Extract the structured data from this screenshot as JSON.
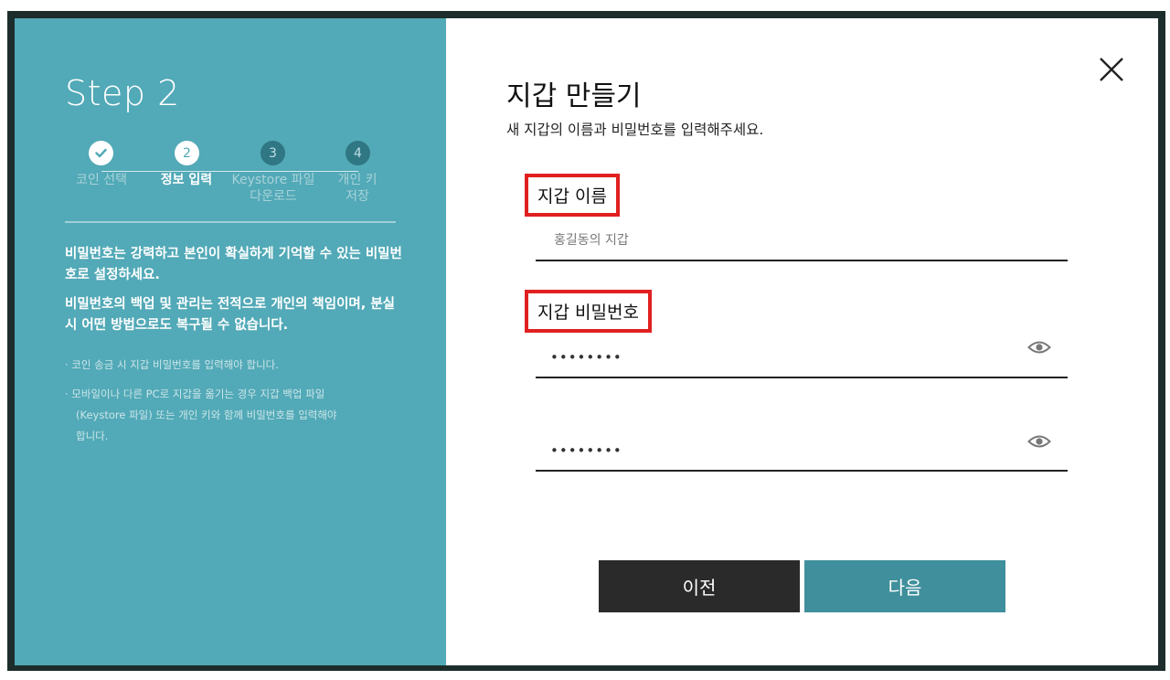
{
  "left": {
    "step_title": "Step 2",
    "steps": [
      {
        "number": "✓",
        "label_lines": [
          "코인 선택"
        ],
        "state": "done"
      },
      {
        "number": "2",
        "label_lines": [
          "정보 입력"
        ],
        "state": "active"
      },
      {
        "number": "3",
        "label_lines": [
          "Keystore 파일",
          "다운로드"
        ],
        "state": "todo"
      },
      {
        "number": "4",
        "label_lines": [
          "개인 키",
          "저장"
        ],
        "state": "todo"
      }
    ],
    "info_1": "비밀번호는 강력하고 본인이 확실하게 기억할 수 있는 비밀번호로 설정하세요.",
    "info_2": "비밀번호의 백업 및 관리는 전적으로 개인의 책임이며, 분실 시 어떤 방법으로도 복구될 수 없습니다.",
    "note_1": "· 코인 송금 시 지갑 비밀번호를 입력해야 합니다.",
    "note_2_line1": "· 모바일이나 다른 PC로 지갑을 옮기는 경우 지갑 백업 파일",
    "note_2_line2": "(Keystore 파일) 또는 개인 키와 함께 비밀번호를 입력해야",
    "note_2_line3": "합니다."
  },
  "dialog": {
    "title": "지갑 만들기",
    "subtitle": "새 지갑의 이름과 비밀번호를 입력해주세요.",
    "close_icon": "close-icon",
    "name_label": "지갑 이름",
    "name_placeholder": "홍길동의 지갑",
    "password_label": "지갑 비밀번호",
    "password_value": "••••••••",
    "password_confirm_value": "••••••••",
    "eye_icon": "eye-icon",
    "prev_button": "이전",
    "next_button": "다음"
  },
  "colors": {
    "left_panel": "#52a9b7",
    "prev_button": "#2a2a2a",
    "next_button": "#3f8f9c",
    "highlight_box": "#e02020"
  }
}
